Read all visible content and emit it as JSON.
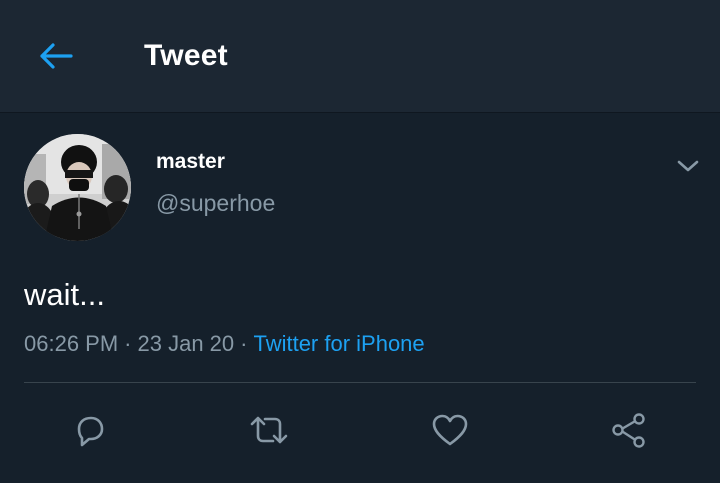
{
  "header": {
    "title": "Tweet",
    "back_icon": "arrow-left-icon"
  },
  "tweet": {
    "author": {
      "display_name": "master",
      "handle": "@superhoe"
    },
    "text": "wait...",
    "time": "06:26 PM",
    "date": "23 Jan 20",
    "separator": "·",
    "source": "Twitter for iPhone"
  },
  "actions": {
    "reply_icon": "reply-icon",
    "retweet_icon": "retweet-icon",
    "like_icon": "heart-icon",
    "share_icon": "share-icon"
  },
  "colors": {
    "background": "#15202b",
    "header_background": "#1c2733",
    "accent": "#1da1f2",
    "secondary_text": "#8899a6",
    "primary_text": "#ffffff"
  }
}
